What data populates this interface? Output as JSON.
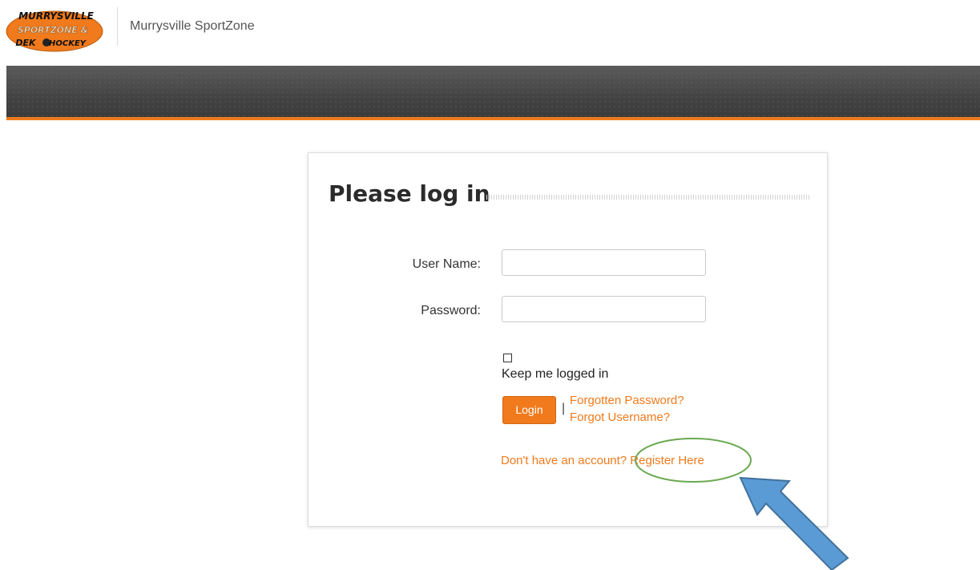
{
  "header": {
    "logo": {
      "line1": "MURRYSVILLE",
      "line2": "SPORTZONE &",
      "line3a": "DEK",
      "line3b": "HOCKEY"
    },
    "site_name": "Murrysville SportZone"
  },
  "login": {
    "title": "Please log in",
    "username_label": "User Name:",
    "username_value": "",
    "password_label": "Password:",
    "password_value": "",
    "keep_logged_in_label": "Keep me logged in",
    "keep_logged_in_checked": false,
    "login_button": "Login",
    "separator": "|",
    "forgotten_password": "Forgotten Password?",
    "forgot_username": "Forgot Username?",
    "register_text": "Don't have an account? Register Here"
  },
  "colors": {
    "accent": "#f07a1c",
    "navbar": "#444444",
    "annotation_circle": "#6aa84f",
    "annotation_arrow": "#5b9bd5"
  }
}
